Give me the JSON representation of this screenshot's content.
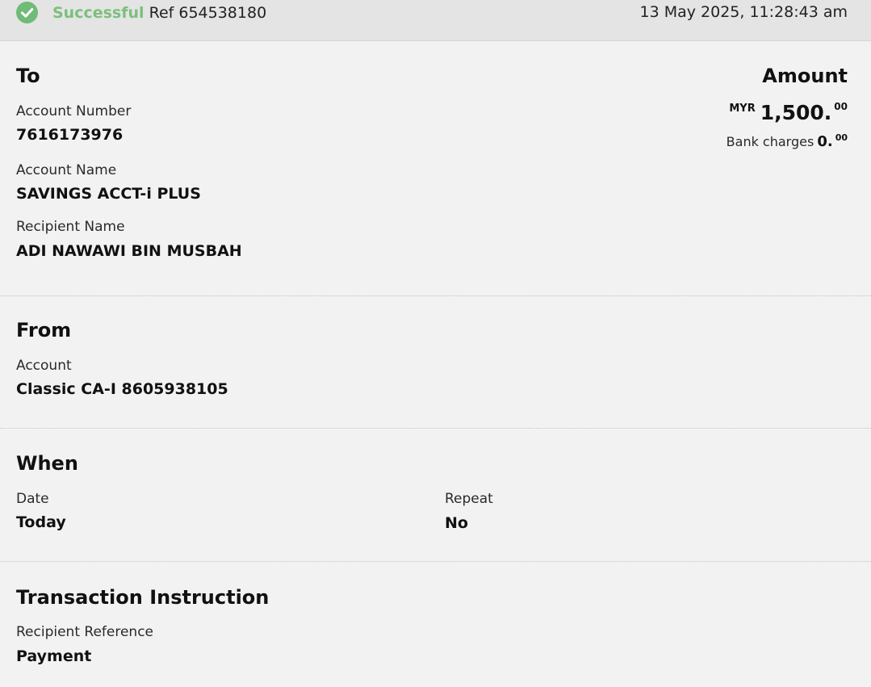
{
  "status": {
    "label": "Successful",
    "ref": "Ref 654538180",
    "timestamp": "13 May 2025, 11:28:43 am",
    "accent_color": "#6fbb78"
  },
  "to": {
    "heading": "To",
    "account_number_label": "Account Number",
    "account_number": "7616173976",
    "account_name_label": "Account Name",
    "account_name": "SAVINGS ACCT-i PLUS",
    "recipient_name_label": "Recipient Name",
    "recipient_name": "ADI NAWAWI BIN MUSBAH"
  },
  "amount": {
    "heading": "Amount",
    "currency": "MYR",
    "whole": "1,500.",
    "cents": "00",
    "charges_label": "Bank charges",
    "charges_whole": "0.",
    "charges_cents": "00"
  },
  "from": {
    "heading": "From",
    "account_label": "Account",
    "account": "Classic CA-I 8605938105"
  },
  "when": {
    "heading": "When",
    "date_label": "Date",
    "date": "Today",
    "repeat_label": "Repeat",
    "repeat": "No"
  },
  "instruction": {
    "heading": "Transaction Instruction",
    "recipient_reference_label": "Recipient Reference",
    "recipient_reference": "Payment"
  },
  "icons": {
    "status": "check-circle-icon"
  }
}
